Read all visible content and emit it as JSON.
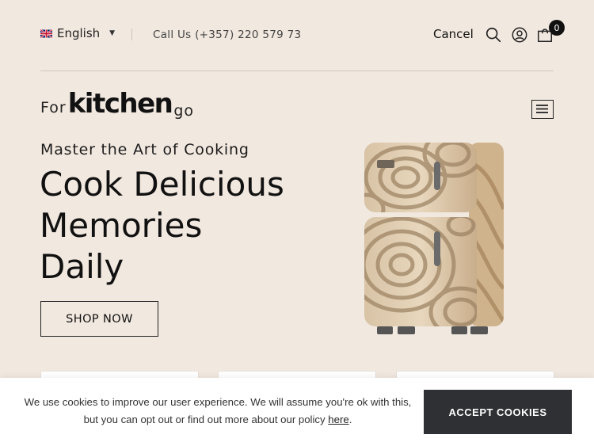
{
  "topbar": {
    "language": "English",
    "phone": "Call Us (+357) 220 579 73",
    "cancel_label": "Cancel",
    "cart_count": "0"
  },
  "logo": {
    "for": "For",
    "kitchen": "kitchen",
    "go": "go"
  },
  "hero": {
    "eyebrow": "Master the Art of Cooking",
    "headline_lines": [
      "Cook Delicious",
      "Memories",
      "Daily"
    ],
    "cta": "SHOP NOW"
  },
  "cookie": {
    "text": "We use cookies to improve our user experience. We will assume you're ok with this, but you can opt out or find out more about our policy ",
    "link": "here",
    "end": ".",
    "accept": "ACCEPT COOKIES"
  },
  "icons": [
    "uk-flag-icon",
    "chevron-down-icon",
    "search-icon",
    "user-icon",
    "cart-icon",
    "hamburger-menu-icon"
  ],
  "colors": {
    "background": "#f1e8df",
    "accent_dark": "#2e3033",
    "text": "#111111"
  }
}
